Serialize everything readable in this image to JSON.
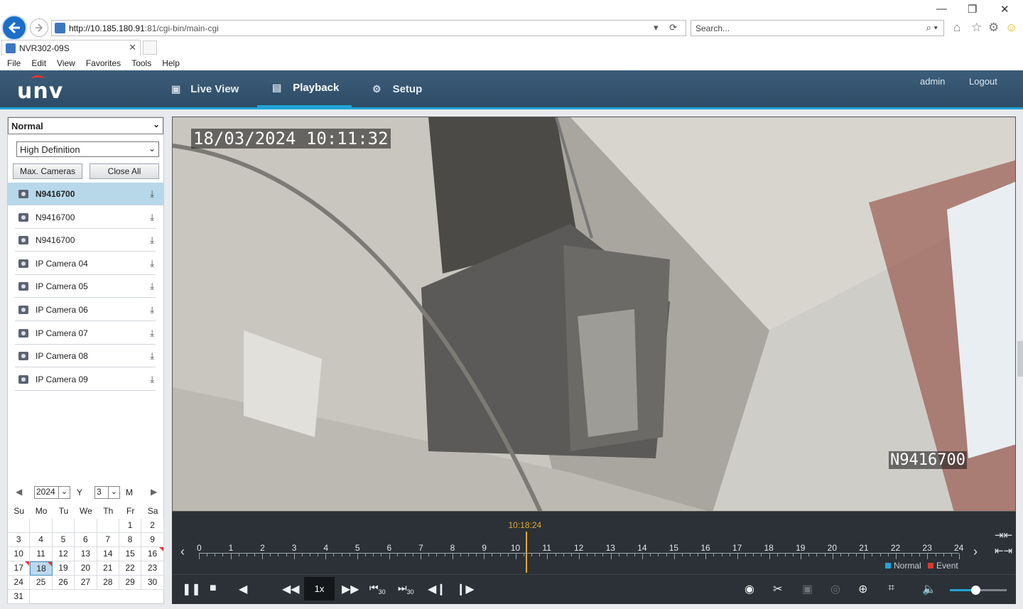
{
  "browser": {
    "url_host": "http://10.185.180.91",
    "url_rest": ":81/cgi-bin/main-cgi",
    "search_placeholder": "Search...",
    "tab_title": "NVR302-09S",
    "menu": [
      "File",
      "Edit",
      "View",
      "Favorites",
      "Tools",
      "Help"
    ]
  },
  "header": {
    "logo": "unv",
    "nav": [
      {
        "label": "Live View",
        "icon": "monitor-icon"
      },
      {
        "label": "Playback",
        "icon": "film-icon"
      },
      {
        "label": "Setup",
        "icon": "gear-icon"
      }
    ],
    "user": "admin",
    "logout": "Logout"
  },
  "sidebar": {
    "mode_select": "Normal",
    "quality_select": "High Definition",
    "max_cameras_label": "Max. Cameras",
    "close_all_label": "Close All",
    "cameras": [
      {
        "label": "N9416700",
        "selected": true
      },
      {
        "label": "N9416700",
        "selected": false
      },
      {
        "label": "N9416700",
        "selected": false
      },
      {
        "label": "IP Camera 04",
        "selected": false
      },
      {
        "label": "IP Camera 05",
        "selected": false
      },
      {
        "label": "IP Camera 06",
        "selected": false
      },
      {
        "label": "IP Camera 07",
        "selected": false
      },
      {
        "label": "IP Camera 08",
        "selected": false
      },
      {
        "label": "IP Camera 09",
        "selected": false
      }
    ]
  },
  "calendar": {
    "year": "2024",
    "year_suffix": "Y",
    "month": "3",
    "month_suffix": "M",
    "weekdays": [
      "Su",
      "Mo",
      "Tu",
      "We",
      "Th",
      "Fr",
      "Sa"
    ],
    "days": [
      "",
      "",
      "",
      "",
      "",
      "1",
      "2",
      "3",
      "4",
      "5",
      "6",
      "7",
      "8",
      "9",
      "10",
      "11",
      "12",
      "13",
      "14",
      "15",
      "16",
      "17",
      "18",
      "19",
      "20",
      "21",
      "22",
      "23",
      "24",
      "25",
      "26",
      "27",
      "28",
      "29",
      "30",
      "31"
    ],
    "recorded_days": [
      "16",
      "17",
      "18"
    ],
    "selected_day": "18"
  },
  "video": {
    "osd_timestamp": "18/03/2024 10:11:32",
    "osd_camera": "N9416700"
  },
  "timeline": {
    "current_time": "10:18:24",
    "current_hour_fraction": 10.3067,
    "hours": [
      "0",
      "1",
      "2",
      "3",
      "4",
      "5",
      "6",
      "7",
      "8",
      "9",
      "10",
      "11",
      "12",
      "13",
      "14",
      "15",
      "16",
      "17",
      "18",
      "19",
      "20",
      "21",
      "22",
      "23",
      "24"
    ],
    "legend_normal": "Normal",
    "legend_event": "Event",
    "normal_color": "#21a4d8",
    "event_color": "#d93a2e"
  },
  "controls": {
    "speed": "1x",
    "skip_back": "30",
    "skip_forward": "30",
    "volume": 0.45
  }
}
